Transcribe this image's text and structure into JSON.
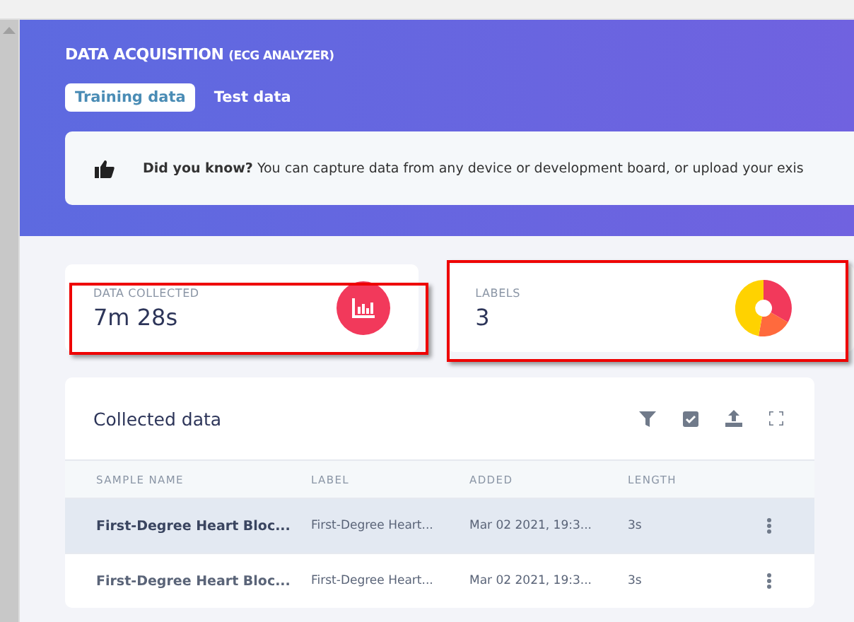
{
  "header": {
    "title": "DATA ACQUISITION",
    "subtitle": "(ECG ANALYZER)"
  },
  "tabs": [
    {
      "label": "Training data",
      "selected": true
    },
    {
      "label": "Test data",
      "selected": false
    }
  ],
  "tip": {
    "text": "**Did you know?** You can capture data from any device or development board, or upload your exis"
  },
  "stats": [
    {
      "kind": "duration",
      "label": "DATA COLLECTED",
      "value": "7m 28s",
      "highlighted": true
    },
    {
      "kind": "labels",
      "label": "LABELS",
      "value": "3",
      "highlighted": true
    }
  ],
  "panel": {
    "title": "Collected data",
    "columns": [
      "SAMPLE NAME",
      "LABEL",
      "ADDED",
      "LENGTH"
    ],
    "rows": [
      {
        "name": "First-Degree Heart Bloc...",
        "label": "First-Degree Heart...",
        "added": "Mar 02 2021, 19:3...",
        "length": "3s",
        "selected": true
      },
      {
        "name": "First-Degree Heart Bloc...",
        "label": "First-Degree Heart...",
        "added": "Mar 02 2021, 19:3...",
        "length": "3s",
        "selected": false
      }
    ]
  }
}
